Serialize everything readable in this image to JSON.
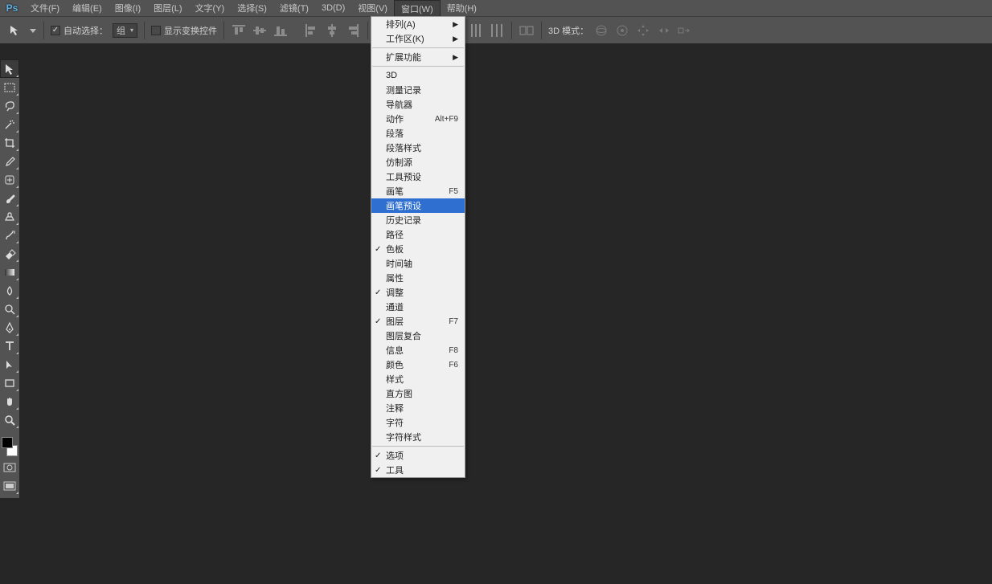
{
  "menubar": {
    "items": [
      {
        "label": "文件(F)"
      },
      {
        "label": "编辑(E)"
      },
      {
        "label": "图像(I)"
      },
      {
        "label": "图层(L)"
      },
      {
        "label": "文字(Y)"
      },
      {
        "label": "选择(S)"
      },
      {
        "label": "滤镜(T)"
      },
      {
        "label": "3D(D)"
      },
      {
        "label": "视图(V)"
      },
      {
        "label": "窗口(W)",
        "active": true
      },
      {
        "label": "帮助(H)"
      }
    ]
  },
  "options": {
    "auto_select_label": "自动选择：",
    "auto_select_value": "组",
    "show_transform_label": "显示变换控件",
    "mode3d_label": "3D 模式："
  },
  "window_menu": {
    "groups": [
      [
        {
          "label": "排列(A)",
          "submenu": true
        },
        {
          "label": "工作区(K)",
          "submenu": true
        }
      ],
      [
        {
          "label": "扩展功能",
          "submenu": true
        }
      ],
      [
        {
          "label": "3D"
        },
        {
          "label": "测量记录"
        },
        {
          "label": "导航器"
        },
        {
          "label": "动作",
          "shortcut": "Alt+F9"
        },
        {
          "label": "段落"
        },
        {
          "label": "段落样式"
        },
        {
          "label": "仿制源"
        },
        {
          "label": "工具预设"
        },
        {
          "label": "画笔",
          "shortcut": "F5"
        },
        {
          "label": "画笔预设",
          "highlight": true
        },
        {
          "label": "历史记录"
        },
        {
          "label": "路径"
        },
        {
          "label": "色板",
          "checked": true
        },
        {
          "label": "时间轴"
        },
        {
          "label": "属性"
        },
        {
          "label": "调整",
          "checked": true
        },
        {
          "label": "通道"
        },
        {
          "label": "图层",
          "checked": true,
          "shortcut": "F7"
        },
        {
          "label": "图层复合"
        },
        {
          "label": "信息",
          "shortcut": "F8"
        },
        {
          "label": "颜色",
          "shortcut": "F6"
        },
        {
          "label": "样式"
        },
        {
          "label": "直方图"
        },
        {
          "label": "注释"
        },
        {
          "label": "字符"
        },
        {
          "label": "字符样式"
        }
      ],
      [
        {
          "label": "选项",
          "checked": true
        },
        {
          "label": "工具",
          "checked": true
        }
      ]
    ]
  },
  "tools": [
    {
      "name": "move-tool",
      "selected": true
    },
    {
      "name": "marquee-tool"
    },
    {
      "name": "lasso-tool"
    },
    {
      "name": "magic-wand-tool"
    },
    {
      "name": "crop-tool"
    },
    {
      "name": "eyedropper-tool"
    },
    {
      "name": "healing-brush-tool"
    },
    {
      "name": "brush-tool"
    },
    {
      "name": "clone-stamp-tool"
    },
    {
      "name": "history-brush-tool"
    },
    {
      "name": "eraser-tool"
    },
    {
      "name": "gradient-tool"
    },
    {
      "name": "blur-tool"
    },
    {
      "name": "dodge-tool"
    },
    {
      "name": "pen-tool"
    },
    {
      "name": "type-tool"
    },
    {
      "name": "path-selection-tool"
    },
    {
      "name": "rectangle-tool"
    },
    {
      "name": "hand-tool"
    },
    {
      "name": "zoom-tool"
    }
  ]
}
